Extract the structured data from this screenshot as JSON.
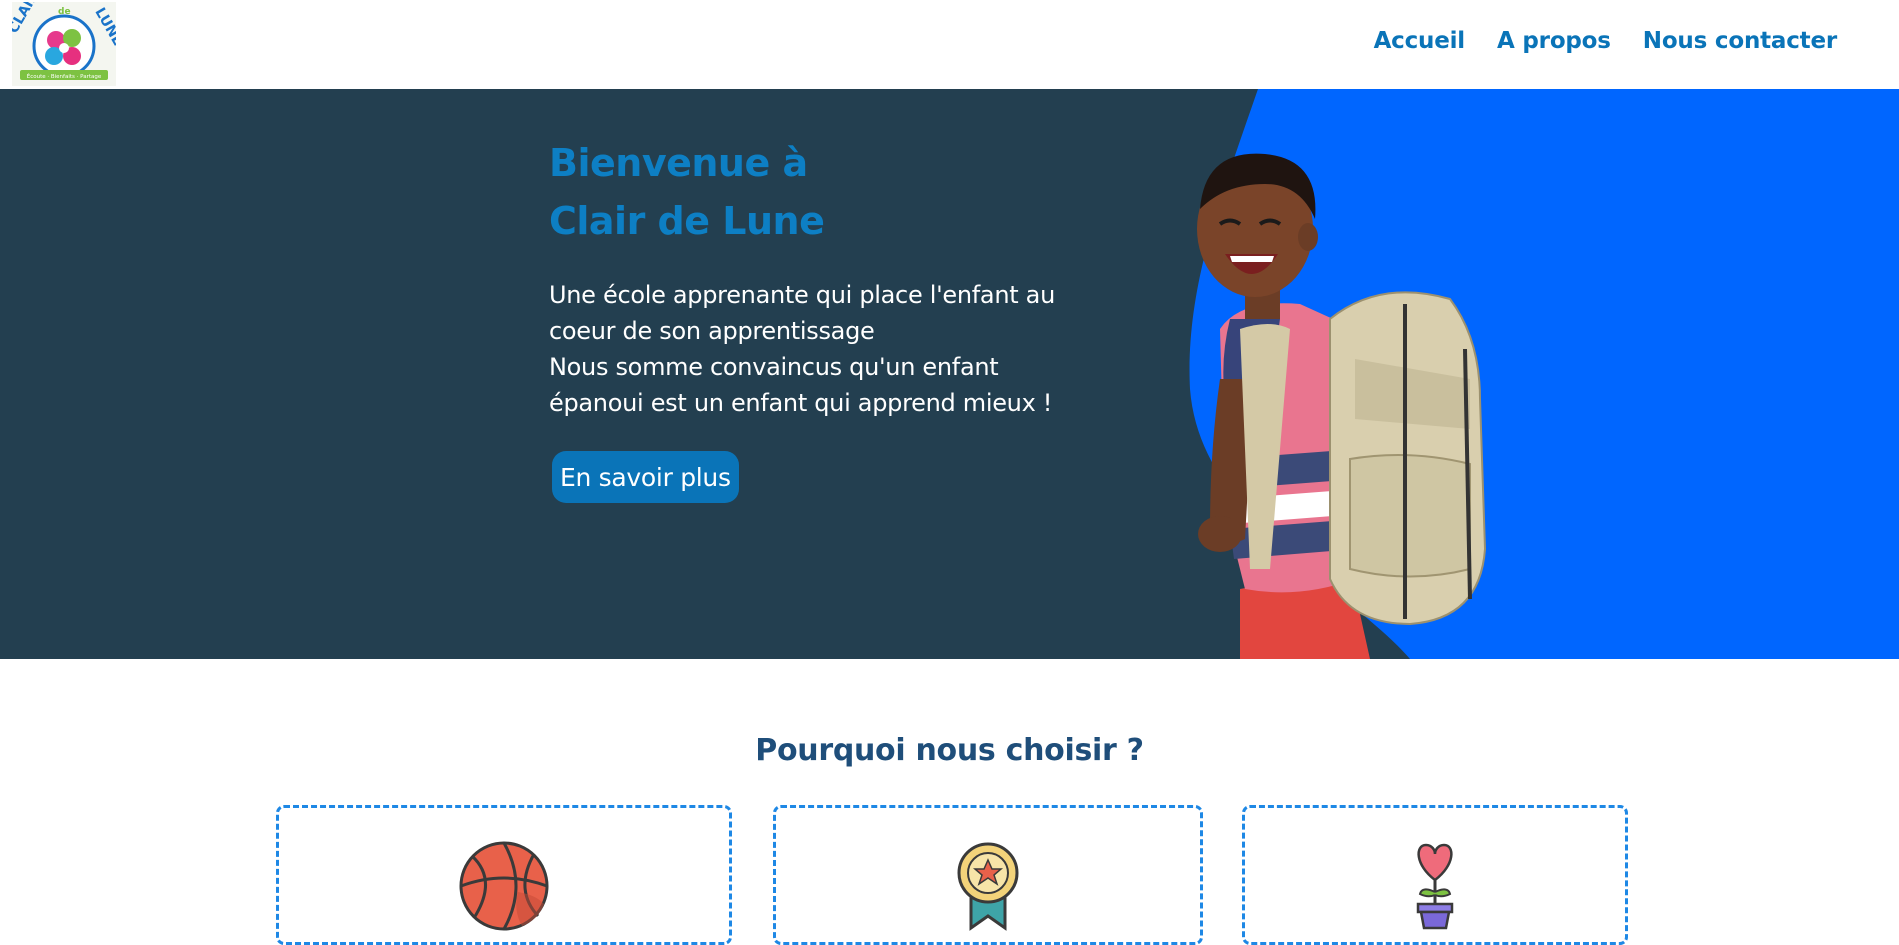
{
  "header": {
    "logo": {
      "top_text": "CLAIR",
      "right_text": "LUNE",
      "middle_text": "de",
      "ribbon_text": "Écoute · Bienfaits · Partage"
    },
    "nav": [
      {
        "label": "Accueil"
      },
      {
        "label": "A propos"
      },
      {
        "label": "Nous contacter"
      }
    ]
  },
  "hero": {
    "title_line1": "Bienvenue à",
    "title_line2": "Clair de Lune",
    "text_lines": [
      "Une école apprenante qui place l'enfant au",
      "coeur de son apprentissage",
      "Nous somme convaincus qu'un enfant",
      "épanoui est un enfant qui apprend mieux !"
    ],
    "button_label": "En savoir plus"
  },
  "why": {
    "title": "Pourquoi nous choisir ?",
    "cards": [
      {
        "icon": "basketball-icon"
      },
      {
        "icon": "medal-icon"
      },
      {
        "icon": "heart-flower-pot-icon"
      }
    ]
  },
  "colors": {
    "brand_blue": "#0a74b8",
    "hero_bg": "#233f50",
    "hero_accent": "#0066ff",
    "section_title": "#1f4e7a",
    "card_border": "#1e88e5"
  }
}
